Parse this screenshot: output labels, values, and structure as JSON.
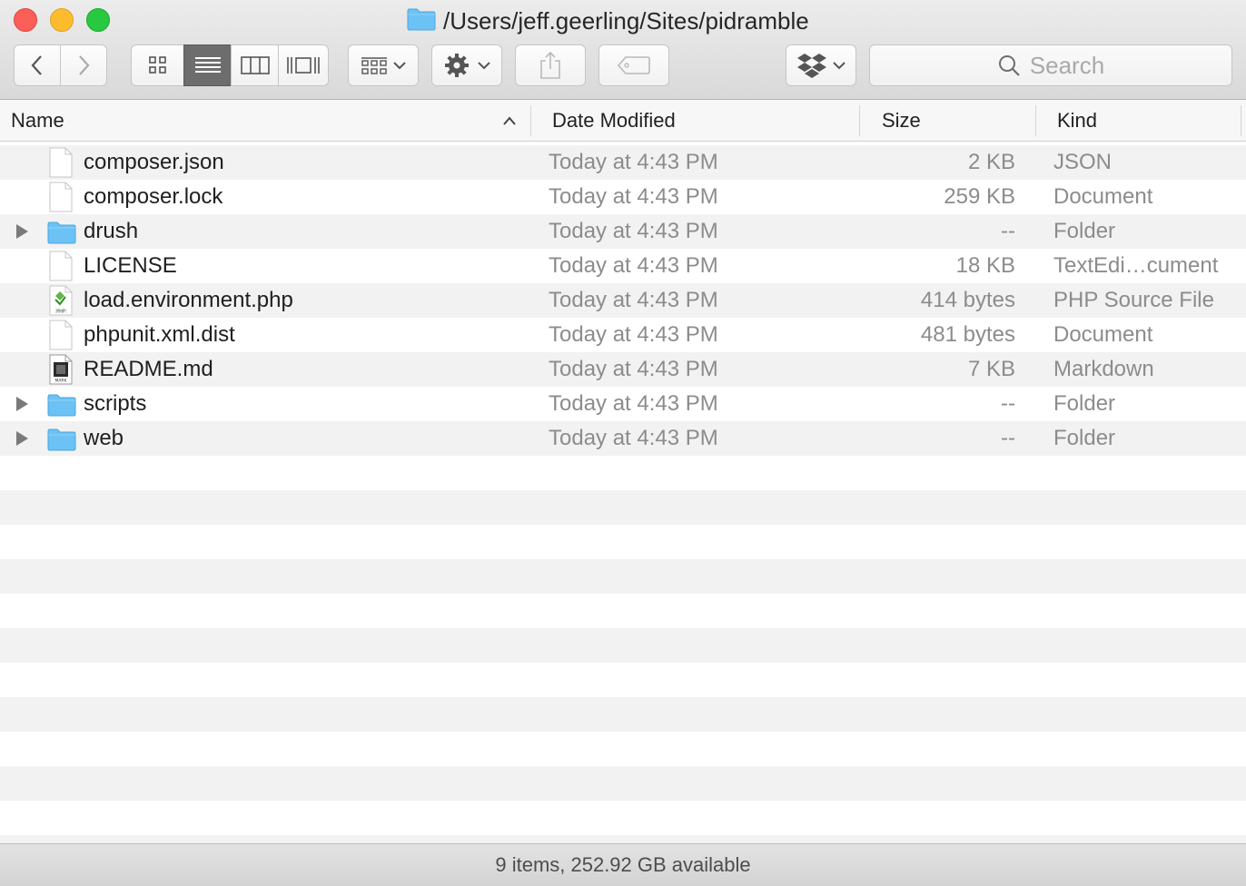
{
  "window": {
    "title": "/Users/jeff.geerling/Sites/pidramble"
  },
  "toolbar": {
    "back_icon": "chevron-left-icon",
    "forward_icon": "chevron-right-icon",
    "view_modes": [
      "icon-view",
      "list-view",
      "column-view",
      "cover-flow-view"
    ],
    "active_view": "list-view",
    "arrange_icon": "arrange-grid-icon",
    "action_icon": "gear-icon",
    "share_icon": "share-icon",
    "tag_icon": "tag-icon",
    "dropbox_icon": "dropbox-icon",
    "search": {
      "placeholder": "Search"
    }
  },
  "columns": {
    "name": "Name",
    "date_modified": "Date Modified",
    "size": "Size",
    "kind": "Kind"
  },
  "files": [
    {
      "name": "composer.json",
      "date": "Today at 4:43 PM",
      "size": "2 KB",
      "kind": "JSON",
      "icon": "document-icon",
      "is_folder": false
    },
    {
      "name": "composer.lock",
      "date": "Today at 4:43 PM",
      "size": "259 KB",
      "kind": "Document",
      "icon": "document-icon",
      "is_folder": false
    },
    {
      "name": "drush",
      "date": "Today at 4:43 PM",
      "size": "--",
      "kind": "Folder",
      "icon": "folder-icon",
      "is_folder": true
    },
    {
      "name": "LICENSE",
      "date": "Today at 4:43 PM",
      "size": "18 KB",
      "kind": "TextEdi…cument",
      "icon": "document-icon",
      "is_folder": false
    },
    {
      "name": "load.environment.php",
      "date": "Today at 4:43 PM",
      "size": "414 bytes",
      "kind": "PHP Source File",
      "icon": "php-file-icon",
      "is_folder": false
    },
    {
      "name": "phpunit.xml.dist",
      "date": "Today at 4:43 PM",
      "size": "481 bytes",
      "kind": "Document",
      "icon": "document-icon",
      "is_folder": false
    },
    {
      "name": "README.md",
      "date": "Today at 4:43 PM",
      "size": "7 KB",
      "kind": "Markdown",
      "icon": "markdown-file-icon",
      "is_folder": false
    },
    {
      "name": "scripts",
      "date": "Today at 4:43 PM",
      "size": "--",
      "kind": "Folder",
      "icon": "folder-icon",
      "is_folder": true
    },
    {
      "name": "web",
      "date": "Today at 4:43 PM",
      "size": "--",
      "kind": "Folder",
      "icon": "folder-icon",
      "is_folder": true
    }
  ],
  "status": {
    "text": "9 items, 252.92 GB available"
  },
  "colors": {
    "folder": "#6cc2f5",
    "close": "#fc5f57",
    "minimize": "#fdbc2e",
    "maximize": "#28c840"
  }
}
